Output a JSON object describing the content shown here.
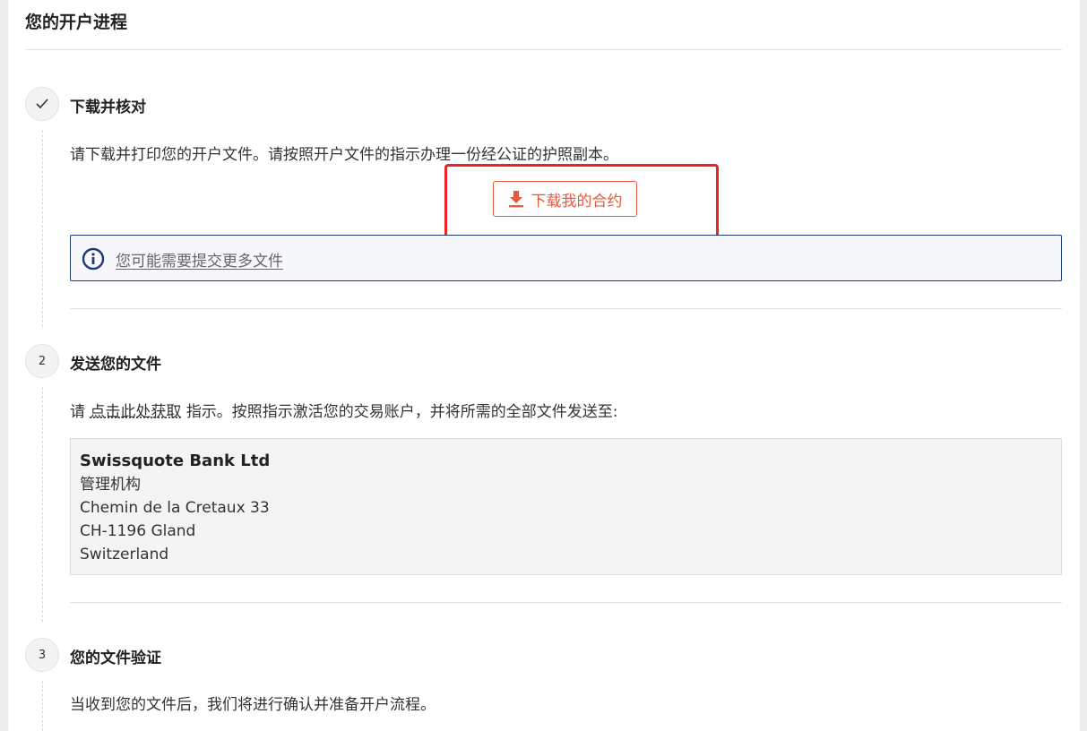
{
  "page_title": "您的开户进程",
  "steps": [
    {
      "marker": "✓",
      "title": "下载并核对",
      "text": "请下载并打印您的开户文件。请按照开户文件的指示办理一份经公证的护照副本。",
      "button_label": "下载我的合约",
      "info_link": "您可能需要提交更多文件"
    },
    {
      "marker": "2",
      "title": "发送您的文件",
      "text_before": "请",
      "link_text": "点击此处获取",
      "text_after": "指示。按照指示激活您的交易账户，并将所需的全部文件发送至:",
      "address": {
        "name": "Swissquote Bank Ltd",
        "line1": "管理机构",
        "line2": "Chemin de la Cretaux 33",
        "line3": "CH-1196 Gland",
        "line4": "Switzerland"
      }
    },
    {
      "marker": "3",
      "title": "您的文件验证",
      "text": "当收到您的文件后，我们将进行确认并准备开户流程。"
    }
  ],
  "colors": {
    "accent": "#e8593c",
    "info_border": "#1f3a78",
    "highlight": "#ee2222"
  }
}
